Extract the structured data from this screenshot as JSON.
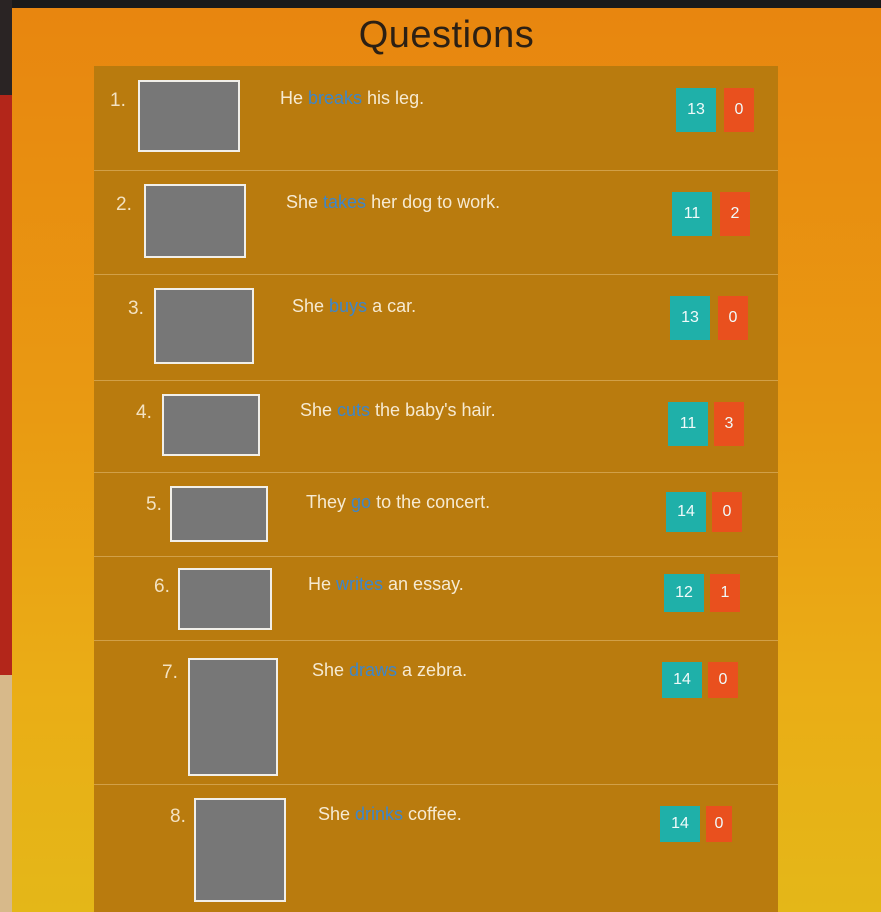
{
  "page": {
    "title": "Questions"
  },
  "colors": {
    "correct": "#1fb0a9",
    "wrong": "#e9501e",
    "verb": "#3d86c9",
    "panel": "#b97b0e"
  },
  "questions": [
    {
      "number": "1.",
      "pre": "He ",
      "verb": "breaks",
      "post": " his leg.",
      "correct": "13",
      "wrong": "0",
      "image": "hospital-photo"
    },
    {
      "number": "2.",
      "pre": "She ",
      "verb": "takes",
      "post": " her dog to work.",
      "correct": "11",
      "wrong": "2",
      "image": "dog-at-work-photo"
    },
    {
      "number": "3.",
      "pre": "She ",
      "verb": "buys",
      "post": " a car.",
      "correct": "13",
      "wrong": "0",
      "image": "car-purchase-photo"
    },
    {
      "number": "4.",
      "pre": "She ",
      "verb": "cuts",
      "post": " the baby's hair.",
      "correct": "11",
      "wrong": "3",
      "image": "baby-haircut-photo"
    },
    {
      "number": "5.",
      "pre": "They ",
      "verb": "go",
      "post": " to the concert.",
      "correct": "14",
      "wrong": "0",
      "image": "concert-crowd-photo"
    },
    {
      "number": "6.",
      "pre": "He ",
      "verb": "writes",
      "post": " an essay.",
      "correct": "12",
      "wrong": "1",
      "image": "boy-writing-photo"
    },
    {
      "number": "7.",
      "pre": "She ",
      "verb": "draws",
      "post": " a zebra.",
      "correct": "14",
      "wrong": "0",
      "image": "zebra-drawing-photo"
    },
    {
      "number": "8.",
      "pre": "She ",
      "verb": "drinks",
      "post": " coffee.",
      "correct": "14",
      "wrong": "0",
      "image": "woman-coffee-photo"
    }
  ]
}
